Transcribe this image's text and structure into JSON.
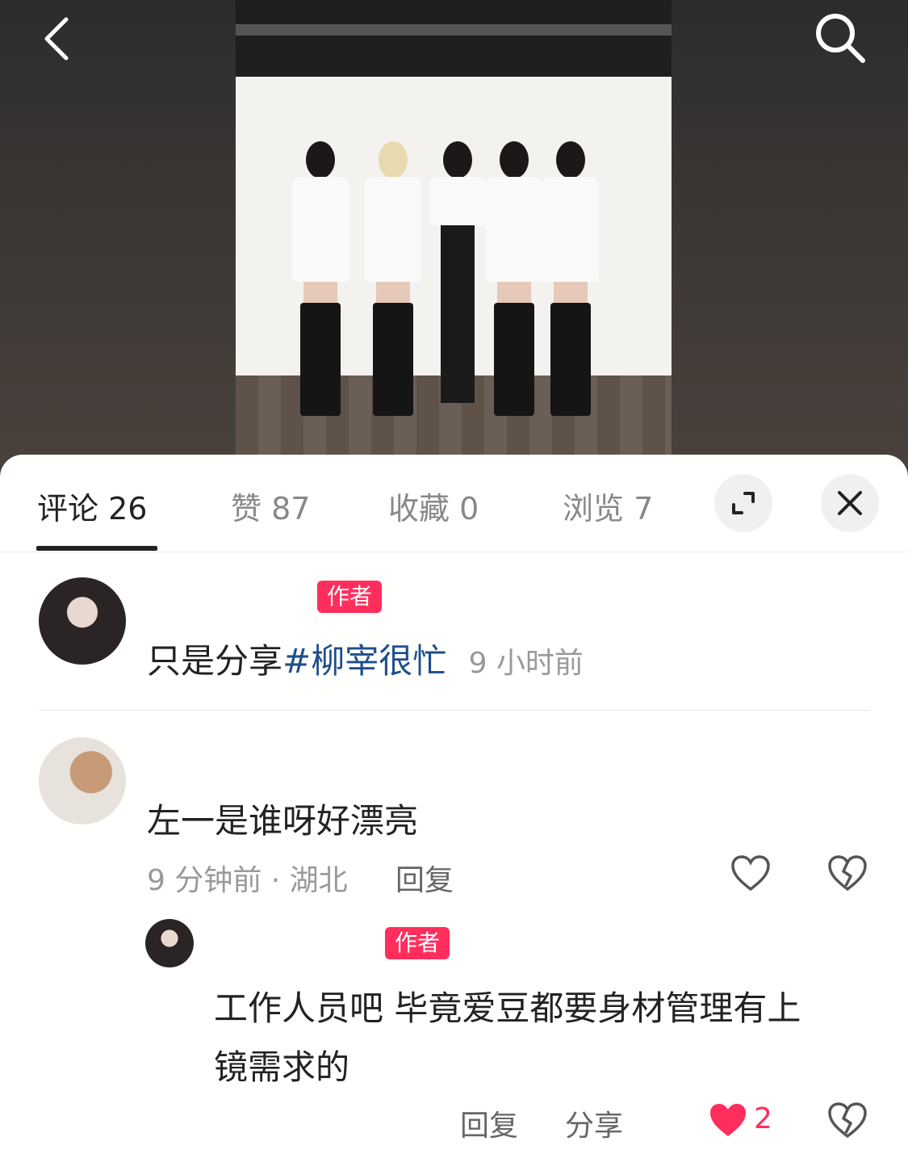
{
  "tabs": [
    {
      "label": "评论 26"
    },
    {
      "label": "赞 87"
    },
    {
      "label": "收藏 0"
    },
    {
      "label": "浏览 7"
    }
  ],
  "comments": [
    {
      "badge": "作者",
      "text_plain": "只是分享",
      "text_tag": "#柳宰很忙",
      "time": "9 小时前"
    },
    {
      "text": "左一是谁呀好漂亮",
      "meta": "9 分钟前 · 湖北",
      "reply_label": "回复"
    }
  ],
  "reply": {
    "badge": "作者",
    "text_line1": "工作人员吧 毕竟爱豆都要身材管理有上",
    "text_line2": "镜需求的",
    "reply_label": "回复",
    "share_label": "分享",
    "like_count": "2"
  },
  "colors": {
    "accent": "#ff2e5d",
    "hashtag": "#1f4e8c"
  }
}
